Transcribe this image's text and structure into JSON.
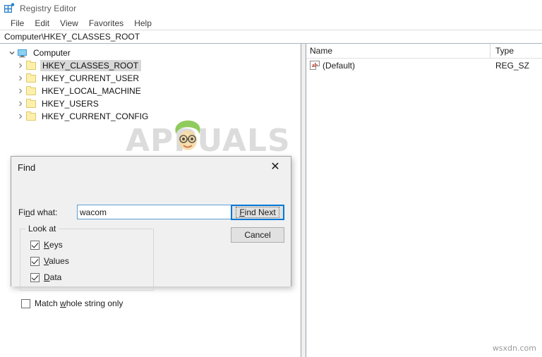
{
  "window": {
    "title": "Registry Editor",
    "icon": "registry-editor-icon"
  },
  "menubar": {
    "items": [
      {
        "label": "File"
      },
      {
        "label": "Edit"
      },
      {
        "label": "View"
      },
      {
        "label": "Favorites"
      },
      {
        "label": "Help"
      }
    ]
  },
  "address_bar": {
    "path": "Computer\\HKEY_CLASSES_ROOT"
  },
  "tree": {
    "root": {
      "label": "Computer",
      "icon": "computer-monitor-icon",
      "expanded": true
    },
    "items": [
      {
        "label": "HKEY_CLASSES_ROOT",
        "icon": "folder-icon",
        "selected": true
      },
      {
        "label": "HKEY_CURRENT_USER",
        "icon": "folder-icon",
        "selected": false
      },
      {
        "label": "HKEY_LOCAL_MACHINE",
        "icon": "folder-icon",
        "selected": false
      },
      {
        "label": "HKEY_USERS",
        "icon": "folder-icon",
        "selected": false
      },
      {
        "label": "HKEY_CURRENT_CONFIG",
        "icon": "folder-icon",
        "selected": false
      }
    ]
  },
  "list": {
    "columns": [
      {
        "label": "Name"
      },
      {
        "label": "Type"
      }
    ],
    "rows": [
      {
        "name": "(Default)",
        "type": "REG_SZ",
        "icon": "string-value-icon",
        "icon_text": "ab"
      }
    ]
  },
  "dialog": {
    "title": "Find",
    "close_label": "✕",
    "find_what_label_pre": "Fi",
    "find_what_label_accel": "n",
    "find_what_label_post": "d what:",
    "find_input_value": "wacom",
    "find_input_placeholder": "",
    "find_next_accel": "F",
    "find_next_rest": "ind Next",
    "cancel_label": "Cancel",
    "group_legend": "Look at",
    "checkboxes": [
      {
        "accel": "K",
        "rest": "eys",
        "checked": true
      },
      {
        "accel": "V",
        "rest": "alues",
        "checked": true
      },
      {
        "accel": "D",
        "rest": "ata",
        "checked": true
      }
    ],
    "match_whole": {
      "pre": "Match ",
      "accel": "w",
      "post": "hole string only",
      "checked": false
    }
  },
  "watermark": {
    "text": "APPUALS",
    "attribution": "wsxdn.com"
  },
  "colors": {
    "accent": "#0078d7",
    "folder": "#fdf0ac",
    "selection": "#d8d8d8",
    "dialog_bg": "#f0f0f0",
    "string_icon": "#b42a17"
  }
}
